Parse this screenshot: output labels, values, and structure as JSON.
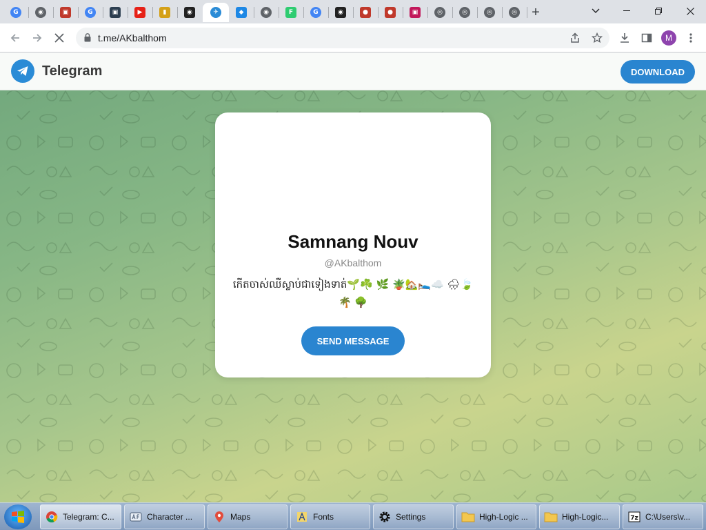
{
  "browser": {
    "tabs": [
      {
        "icon": "google-icon",
        "color": "#4285f4",
        "glyph": "G"
      },
      {
        "icon": "globe-icon",
        "color": "#5f6368",
        "glyph": "◉"
      },
      {
        "icon": "app-icon",
        "color": "#c0392b",
        "glyph": "▣"
      },
      {
        "icon": "google-icon",
        "color": "#4285f4",
        "glyph": "G"
      },
      {
        "icon": "app-icon",
        "color": "#2c3e50",
        "glyph": "▣"
      },
      {
        "icon": "youtube-icon",
        "color": "#e62117",
        "glyph": "▶"
      },
      {
        "icon": "app-icon",
        "color": "#d4a017",
        "glyph": "▮"
      },
      {
        "icon": "app-icon",
        "color": "#222222",
        "glyph": "◉"
      },
      {
        "icon": "telegram-icon",
        "color": "#2a8bd6",
        "glyph": "✈"
      },
      {
        "icon": "app-icon",
        "color": "#1e88e5",
        "glyph": "◆"
      },
      {
        "icon": "globe-icon",
        "color": "#5f6368",
        "glyph": "◉"
      },
      {
        "icon": "app-icon",
        "color": "#2ecc71",
        "glyph": "F"
      },
      {
        "icon": "google-icon",
        "color": "#4285f4",
        "glyph": "G"
      },
      {
        "icon": "app-icon",
        "color": "#222222",
        "glyph": "◉"
      },
      {
        "icon": "app-icon",
        "color": "#c0392b",
        "glyph": "●"
      },
      {
        "icon": "app-icon",
        "color": "#c0392b",
        "glyph": "●"
      },
      {
        "icon": "app-icon",
        "color": "#c2185b",
        "glyph": "▣"
      },
      {
        "icon": "chrome-icon",
        "color": "#5f6368",
        "glyph": "◎"
      },
      {
        "icon": "chrome-icon",
        "color": "#5f6368",
        "glyph": "◎"
      },
      {
        "icon": "chrome-icon",
        "color": "#5f6368",
        "glyph": "◎"
      },
      {
        "icon": "chrome-icon",
        "color": "#5f6368",
        "glyph": "◎"
      }
    ],
    "active_tab": 8,
    "url": "t.me/AKbalthom",
    "profile_initial": "M"
  },
  "telegram": {
    "brand": "Telegram",
    "download_label": "DOWNLOAD",
    "profile_name": "Samnang Nouv",
    "username": "@AKbalthom",
    "bio": "កើតចាស់ឈឺស្លាប់ជាទៀងទាត់🌱☘️ 🌿 🪴🏡🛌☁️ 🌧🍃🌴 🌳",
    "send_label": "SEND MESSAGE",
    "accent": "#2a85d0"
  },
  "taskbar": {
    "items": [
      {
        "label": "Telegram: C...",
        "icon": "chrome-icon",
        "active": true
      },
      {
        "label": "Character ...",
        "icon": "character-map-icon",
        "active": false
      },
      {
        "label": "Maps",
        "icon": "maps-icon",
        "active": false
      },
      {
        "label": "Fonts",
        "icon": "fonts-icon",
        "active": false
      },
      {
        "label": "Settings",
        "icon": "gear-icon",
        "active": false
      },
      {
        "label": "High-Logic ...",
        "icon": "folder-icon",
        "active": false
      },
      {
        "label": "High-Logic...",
        "icon": "folder-icon",
        "active": false
      },
      {
        "label": "C:\\Users\\v...",
        "icon": "7zip-icon",
        "active": false
      }
    ]
  }
}
